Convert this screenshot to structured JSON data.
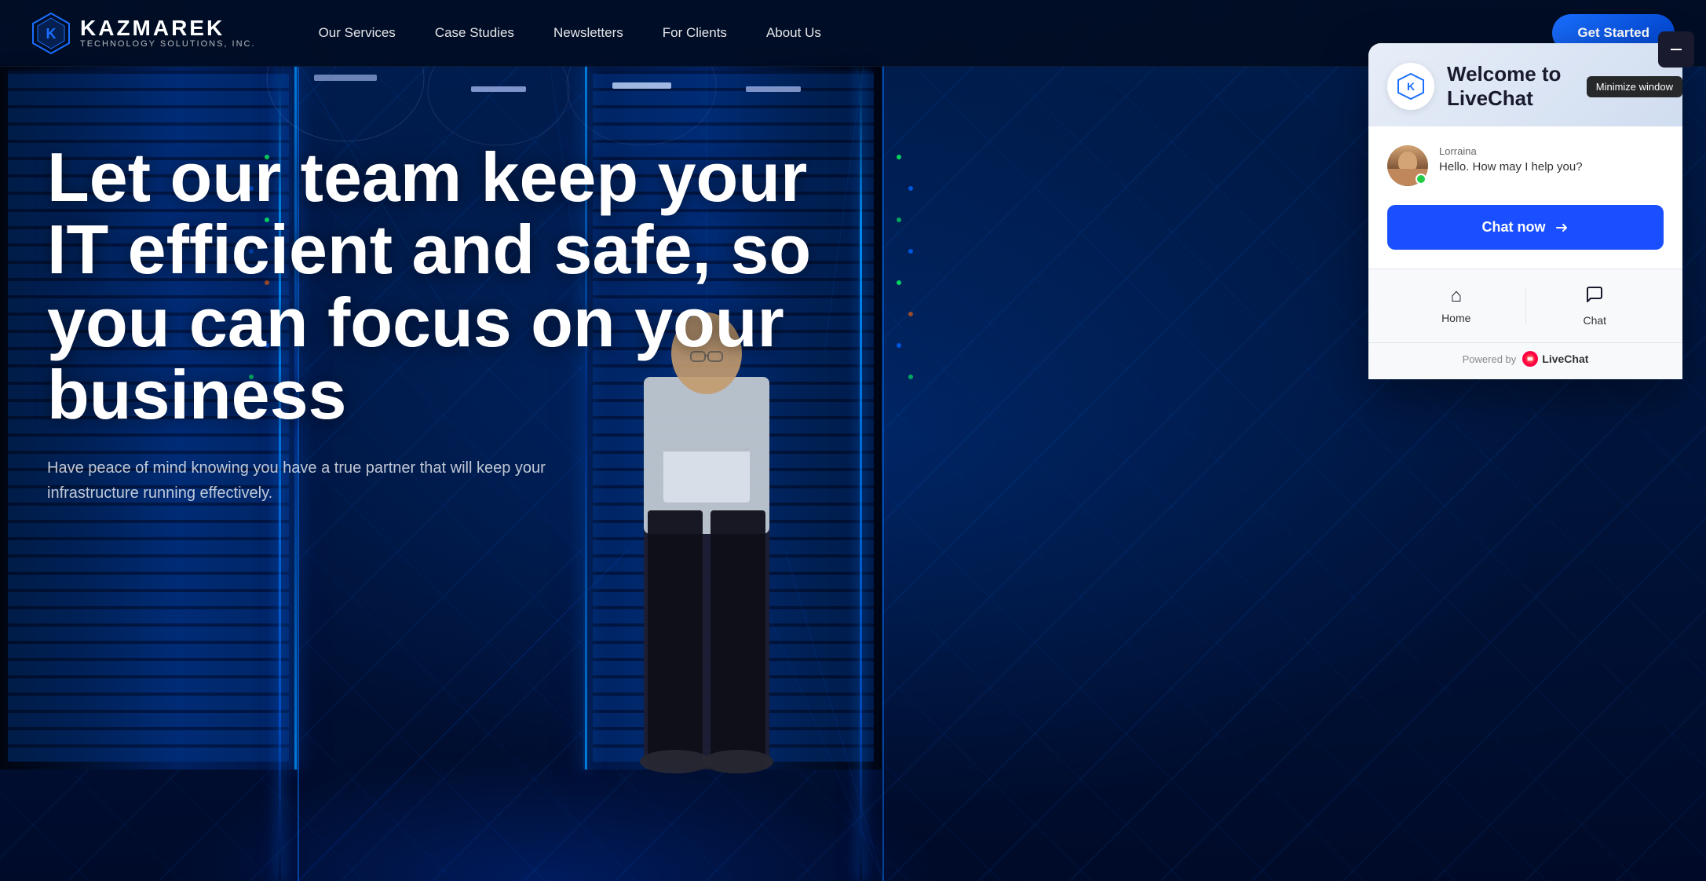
{
  "site": {
    "logo_main": "KAZMAREK",
    "logo_sub": "TECHNOLOGY SOLUTIONS, INC.",
    "cta_button": "Get Started"
  },
  "nav": {
    "items": [
      {
        "label": "Our Services",
        "id": "our-services"
      },
      {
        "label": "Case Studies",
        "id": "case-studies"
      },
      {
        "label": "Newsletters",
        "id": "newsletters"
      },
      {
        "label": "For Clients",
        "id": "for-clients"
      },
      {
        "label": "About Us",
        "id": "about-us"
      }
    ]
  },
  "hero": {
    "headline": "Let our team keep your IT efficient and safe, so you can focus on your business",
    "subtext": "Have peace of mind knowing you have a true partner that will keep your infrastructure running effectively."
  },
  "livechat": {
    "header_title_line1": "Welcome to",
    "header_title_line2": "LiveChat",
    "minimize_tooltip": "Minimize window",
    "agent_name": "Lorraina",
    "agent_message": "Hello. How may I help you?",
    "chat_now_label": "Chat now",
    "tab_home_label": "Home",
    "tab_chat_label": "Chat",
    "powered_by": "Powered by",
    "brand_name": "LiveChat"
  }
}
